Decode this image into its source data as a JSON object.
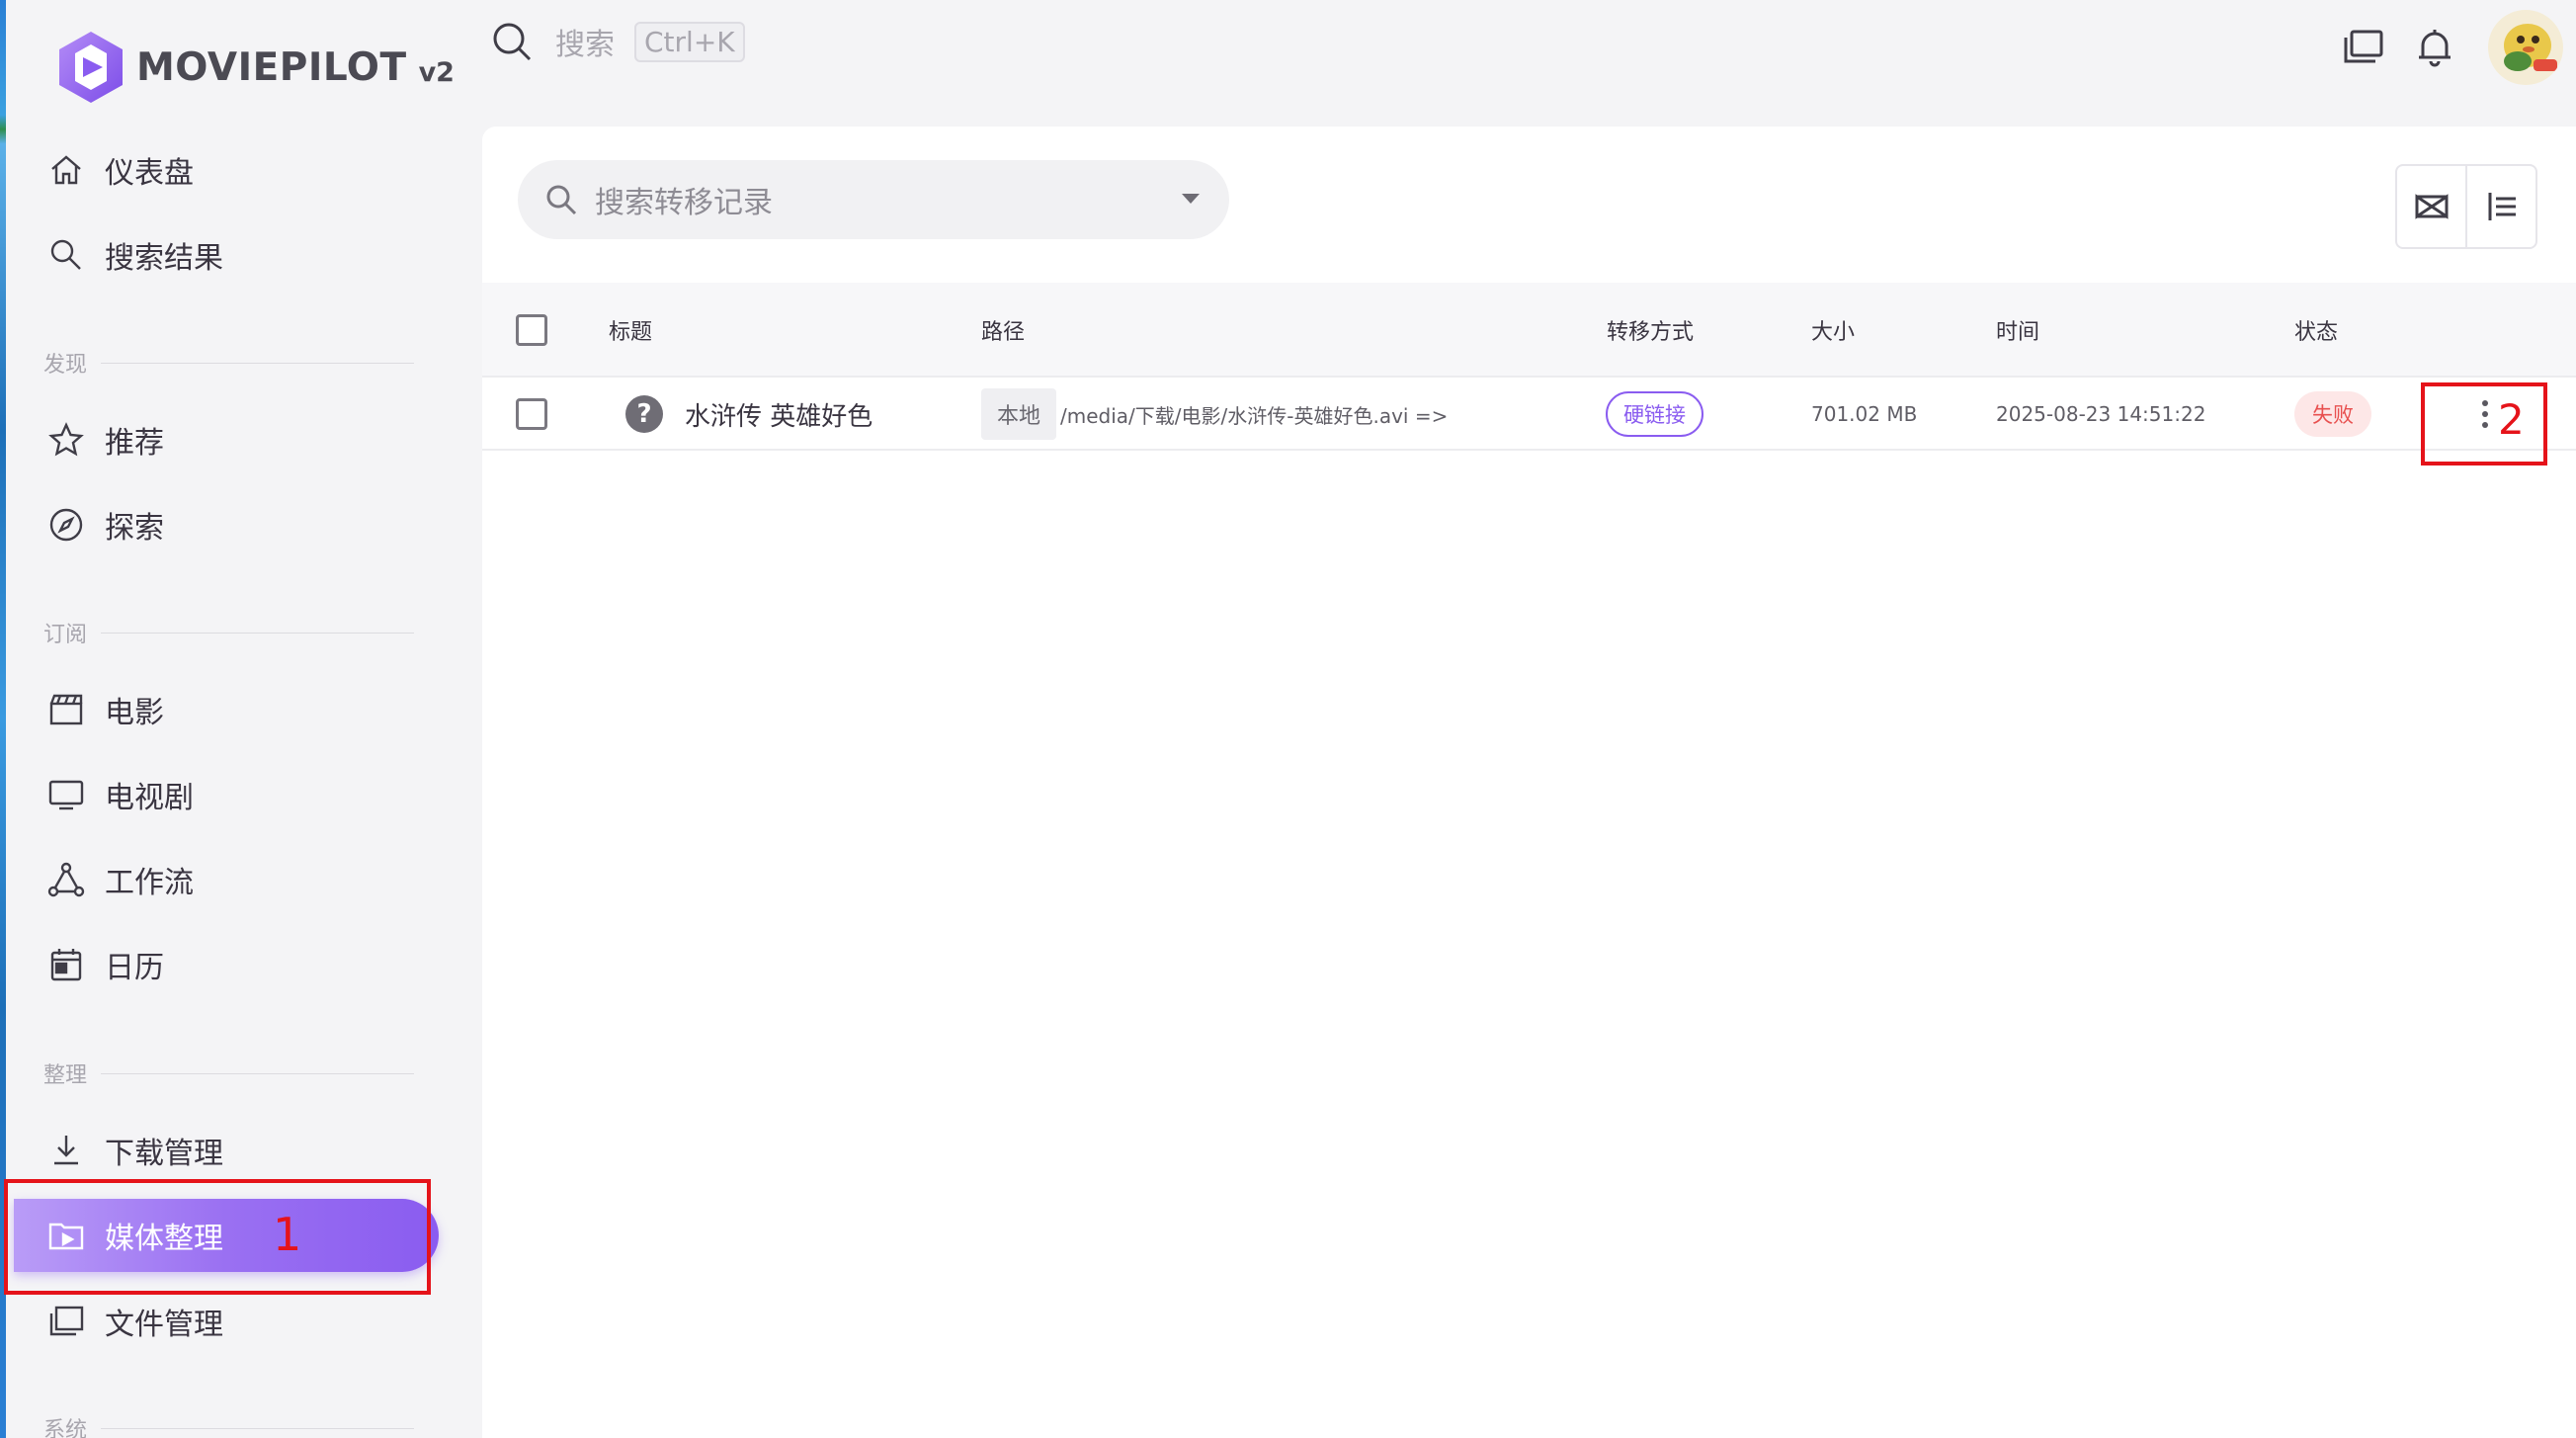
{
  "app": {
    "brand": "MOVIEPILOT",
    "version": "v2"
  },
  "sidebar": {
    "items": [
      {
        "label": "仪表盘",
        "icon": "home-icon"
      },
      {
        "label": "搜索结果",
        "icon": "search-icon"
      },
      {
        "section": "发现"
      },
      {
        "label": "推荐",
        "icon": "star-icon"
      },
      {
        "label": "探索",
        "icon": "compass-icon"
      },
      {
        "section": "订阅"
      },
      {
        "label": "电影",
        "icon": "movie-clapper-icon"
      },
      {
        "label": "电视剧",
        "icon": "tv-icon"
      },
      {
        "label": "工作流",
        "icon": "workflow-icon"
      },
      {
        "label": "日历",
        "icon": "calendar-icon"
      },
      {
        "section": "整理"
      },
      {
        "label": "下载管理",
        "icon": "download-icon"
      },
      {
        "label": "媒体整理",
        "icon": "folder-play-icon",
        "active": true
      },
      {
        "label": "文件管理",
        "icon": "files-icon"
      },
      {
        "section": "系统"
      }
    ]
  },
  "topbar": {
    "search_placeholder": "搜索",
    "shortcut": "Ctrl+K"
  },
  "main": {
    "search_placeholder": "搜索转移记录",
    "table": {
      "columns": [
        "标题",
        "路径",
        "转移方式",
        "大小",
        "时间",
        "状态"
      ],
      "rows": [
        {
          "title": "水浒传 英雄好色",
          "storage": "本地",
          "path": "/media/下载/电影/水浒传-英雄好色.avi =>",
          "mode": "硬链接",
          "size": "701.02 MB",
          "time": "2025-08-23 14:51:22",
          "status": "失败"
        }
      ]
    }
  },
  "annotations": {
    "marker_1": "1",
    "marker_2": "2"
  },
  "colors": {
    "accent": "#8a5cf0",
    "status_fail": "#e8504f",
    "annotation": "#e5131a"
  }
}
